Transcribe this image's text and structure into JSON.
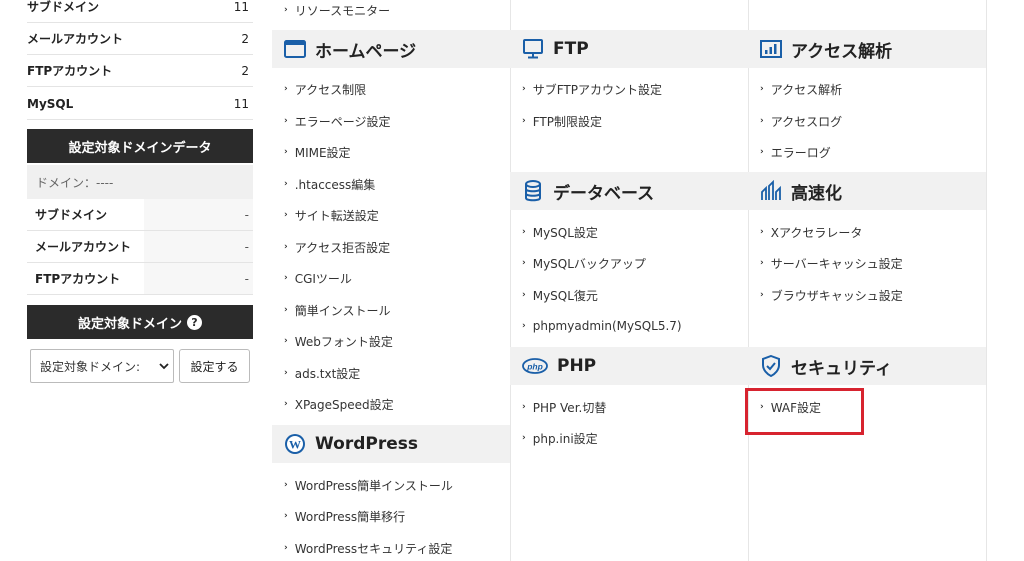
{
  "sidebar": {
    "stats": [
      {
        "label": "サブドメイン",
        "value": "11"
      },
      {
        "label": "メールアカウント",
        "value": "2"
      },
      {
        "label": "FTPアカウント",
        "value": "2"
      },
      {
        "label": "MySQL",
        "value": "11"
      }
    ],
    "target_data_title": "設定対象ドメインデータ",
    "domain_line": "ドメイン：----",
    "domain_info": [
      {
        "label": "サブドメイン",
        "value": "-"
      },
      {
        "label": "メールアカウント",
        "value": "-"
      },
      {
        "label": "FTPアカウント",
        "value": "-"
      }
    ],
    "target_domain_title": "設定対象ドメイン",
    "help_icon": "?",
    "select_value": "設定対象ドメイン:",
    "apply_button": "設定する"
  },
  "col1": {
    "top_item": "リソースモニター",
    "homepage": {
      "title": "ホームページ",
      "icon": "window-icon",
      "items": [
        "アクセス制限",
        "エラーページ設定",
        "MIME設定",
        ".htaccess編集",
        "サイト転送設定",
        "アクセス拒否設定",
        "CGIツール",
        "簡単インストール",
        "Webフォント設定",
        "ads.txt設定",
        "XPageSpeed設定"
      ]
    },
    "wordpress": {
      "title": "WordPress",
      "icon": "wordpress-icon",
      "items": [
        "WordPress簡単インストール",
        "WordPress簡単移行",
        "WordPressセキュリティ設定"
      ]
    }
  },
  "col2": {
    "ftp": {
      "title": "FTP",
      "icon": "monitor-icon",
      "items": [
        "サブFTPアカウント設定",
        "FTP制限設定"
      ]
    },
    "database": {
      "title": "データベース",
      "icon": "database-icon",
      "items": [
        "MySQL設定",
        "MySQLバックアップ",
        "MySQL復元",
        "phpmyadmin(MySQL5.7)"
      ]
    },
    "php": {
      "title": "PHP",
      "icon": "php-icon",
      "icon_text": "php",
      "items": [
        "PHP Ver.切替",
        "php.ini設定"
      ]
    }
  },
  "col3": {
    "analytics": {
      "title": "アクセス解析",
      "icon": "bar-chart-icon",
      "items": [
        "アクセス解析",
        "アクセスログ",
        "エラーログ"
      ]
    },
    "speed": {
      "title": "高速化",
      "icon": "speed-icon",
      "items": [
        "Xアクセラレータ",
        "サーバーキャッシュ設定",
        "ブラウザキャッシュ設定"
      ]
    },
    "security": {
      "title": "セキュリティ",
      "icon": "shield-icon",
      "items": [
        "WAF設定"
      ]
    }
  },
  "colors": {
    "accent_blue": "#1a5fa8",
    "highlight_red": "#d7232f",
    "dark_header": "#2b2b2b"
  }
}
